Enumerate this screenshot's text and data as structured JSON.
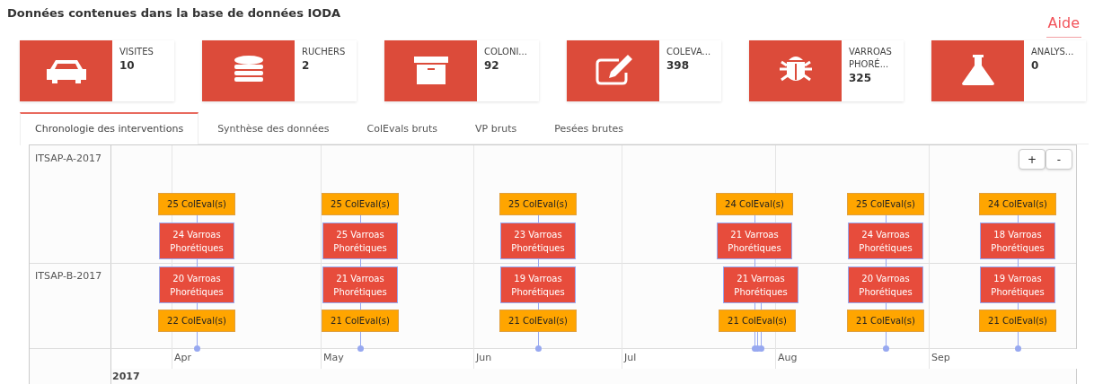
{
  "title": "Données contenues dans la base de données IODA",
  "help_link": "Aide",
  "stats": [
    {
      "kind": "car",
      "label": "VISITES",
      "value": "10"
    },
    {
      "kind": "database",
      "label": "RUCHERS",
      "value": "2"
    },
    {
      "kind": "box",
      "label": "COLONI...",
      "value": "92"
    },
    {
      "kind": "edit",
      "label": "COLEVA...",
      "value": "398"
    },
    {
      "kind": "bug",
      "label": "VARROAS PHORÉ...",
      "value": "325"
    },
    {
      "kind": "flask",
      "label": "ANALYS...",
      "value": "0"
    }
  ],
  "tabs": [
    {
      "label": "Chronologie des interventions",
      "selected": true
    },
    {
      "label": "Synthèse des données",
      "selected": false
    },
    {
      "label": "ColEvals bruts",
      "selected": false
    },
    {
      "label": "VP bruts",
      "selected": false
    },
    {
      "label": "Pesées brutes",
      "selected": false
    }
  ],
  "timeline": {
    "zoom_buttons": [
      "+",
      "-"
    ],
    "groups": [
      {
        "name": "ITSAP-A-2017",
        "lanes": [
          [
            {
              "kind": "coleval",
              "text": "25 ColEval(s)"
            },
            {
              "kind": "coleval",
              "text": "25 ColEval(s)"
            },
            {
              "kind": "coleval",
              "text": "25 ColEval(s)"
            },
            {
              "kind": "coleval",
              "text": "24 ColEval(s)"
            },
            {
              "kind": "coleval",
              "text": "25 ColEval(s)"
            },
            {
              "kind": "coleval",
              "text": "24 ColEval(s)"
            }
          ],
          [
            {
              "kind": "varroa",
              "text": "24 Varroas Phorétiques"
            },
            {
              "kind": "varroa",
              "text": "25 Varroas Phorétiques"
            },
            {
              "kind": "varroa",
              "text": "23 Varroas Phorétiques"
            },
            {
              "kind": "varroa",
              "text": "21 Varroas Phorétiques"
            },
            {
              "kind": "varroa",
              "text": "24 Varroas Phorétiques"
            },
            {
              "kind": "varroa",
              "text": "18 Varroas Phorétiques"
            }
          ]
        ]
      },
      {
        "name": "ITSAP-B-2017",
        "lanes": [
          [
            {
              "kind": "varroa",
              "text": "20 Varroas Phorétiques"
            },
            {
              "kind": "varroa",
              "text": "21 Varroas Phorétiques"
            },
            {
              "kind": "varroa",
              "text": "19 Varroas Phorétiques"
            },
            {
              "kind": "varroa",
              "text": "21 Varroas Phorétiques"
            },
            {
              "kind": "varroa",
              "text": "20 Varroas Phorétiques"
            },
            {
              "kind": "varroa",
              "text": "19 Varroas Phorétiques"
            }
          ],
          [
            {
              "kind": "coleval",
              "text": "22 ColEval(s)"
            },
            {
              "kind": "coleval",
              "text": "21 ColEval(s)"
            },
            {
              "kind": "coleval",
              "text": "21 ColEval(s)"
            },
            {
              "kind": "coleval",
              "text": "21 ColEval(s)"
            },
            {
              "kind": "coleval",
              "text": "21 ColEval(s)"
            },
            {
              "kind": "coleval",
              "text": "21 ColEval(s)"
            }
          ]
        ]
      }
    ],
    "months": [
      "Apr",
      "May",
      "Jun",
      "Jul",
      "Aug",
      "Sep"
    ],
    "year": "2017"
  }
}
